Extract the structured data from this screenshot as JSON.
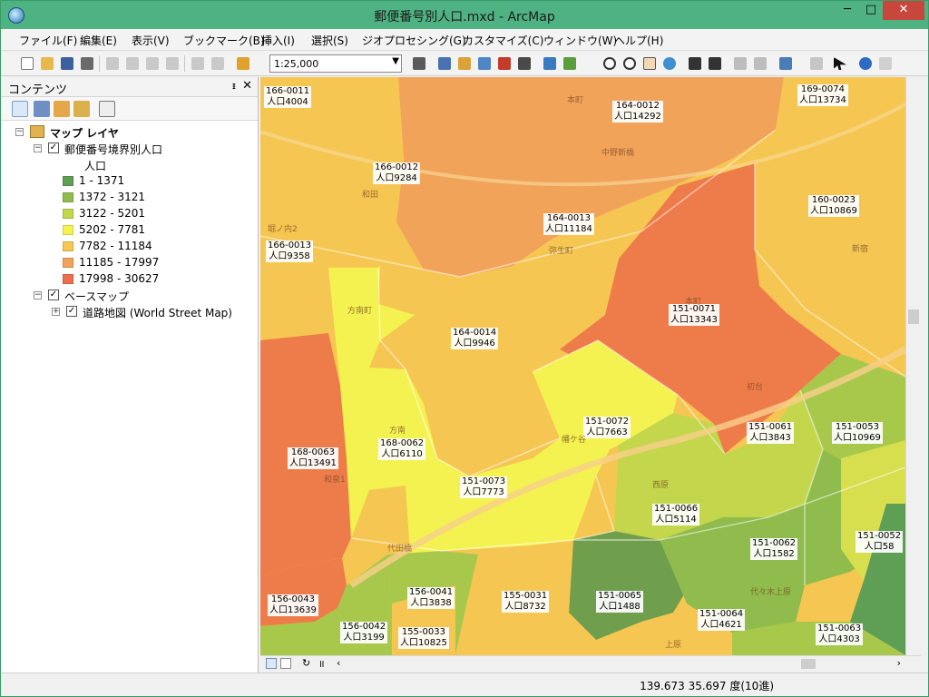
{
  "window": {
    "title": "郵便番号別人口.mxd - ArcMap",
    "min": "─",
    "max": "□",
    "close": "✕"
  },
  "menu": [
    "ファイル(F)",
    "編集(E)",
    "表示(V)",
    "ブックマーク(B)",
    "挿入(I)",
    "選択(S)",
    "ジオプロセシング(G)",
    "カスタマイズ(C)",
    "ウィンドウ(W)",
    "ヘルプ(H)"
  ],
  "toolbar": {
    "scale_value": "1:25,000"
  },
  "toc": {
    "title": "コンテンツ",
    "pin": "ᵻ",
    "close": "✕",
    "root": "マップ レイヤ",
    "layer1": "郵便番号境界別人口",
    "field": "人口",
    "legend": [
      {
        "label": "1 - 1371",
        "color": "#5e9e55"
      },
      {
        "label": "1372 - 3121",
        "color": "#8fbc4c"
      },
      {
        "label": "3122 - 5201",
        "color": "#c4d64c"
      },
      {
        "label": "5202 - 7781",
        "color": "#f4f250"
      },
      {
        "label": "7782 - 11184",
        "color": "#f6c652"
      },
      {
        "label": "11185 - 17997",
        "color": "#f2a35a"
      },
      {
        "label": "17998 - 30627",
        "color": "#ee6d4f"
      }
    ],
    "layer2": "ベースマップ",
    "layer3": "道路地図 (World Street Map)"
  },
  "map_labels": [
    {
      "code": "166-0011",
      "pop": "人口4004"
    },
    {
      "code": "164-0012",
      "pop": "人口14292"
    },
    {
      "code": "169-0074",
      "pop": "人口13734"
    },
    {
      "code": "166-0012",
      "pop": "人口9284"
    },
    {
      "code": "164-0013",
      "pop": "人口11184"
    },
    {
      "code": "160-0023",
      "pop": "人口10869"
    },
    {
      "code": "166-0013",
      "pop": "人口9358"
    },
    {
      "code": "151-0071",
      "pop": "人口13343"
    },
    {
      "code": "164-0014",
      "pop": "人口9946"
    },
    {
      "code": "151-0072",
      "pop": "人口7663"
    },
    {
      "code": "151-0061",
      "pop": "人口3843"
    },
    {
      "code": "151-0053",
      "pop": "人口10969"
    },
    {
      "code": "168-0063",
      "pop": "人口13491"
    },
    {
      "code": "168-0062",
      "pop": "人口6110"
    },
    {
      "code": "151-0073",
      "pop": "人口7773"
    },
    {
      "code": "151-0066",
      "pop": "人口5114"
    },
    {
      "code": "151-0062",
      "pop": "人口1582"
    },
    {
      "code": "151-0052",
      "pop": "人口58"
    },
    {
      "code": "156-0041",
      "pop": "人口3838"
    },
    {
      "code": "155-0031",
      "pop": "人口8732"
    },
    {
      "code": "151-0065",
      "pop": "人口1488"
    },
    {
      "code": "156-0043",
      "pop": "人口13639"
    },
    {
      "code": "151-0064",
      "pop": "人口4621"
    },
    {
      "code": "156-0042",
      "pop": "人口3199"
    },
    {
      "code": "155-0033",
      "pop": "人口10825"
    },
    {
      "code": "151-0063",
      "pop": "人口4303"
    }
  ],
  "place_names": [
    "本町",
    "中野新橋",
    "和田",
    "弥生町",
    "堀ノ内2",
    "方南町",
    "本町",
    "方南",
    "幡ケ谷",
    "初台",
    "新宿",
    "和泉1",
    "代田橋",
    "西原",
    "上原",
    "代々木上原"
  ],
  "status": {
    "coords": "139.673  35.697 度(10進)"
  }
}
